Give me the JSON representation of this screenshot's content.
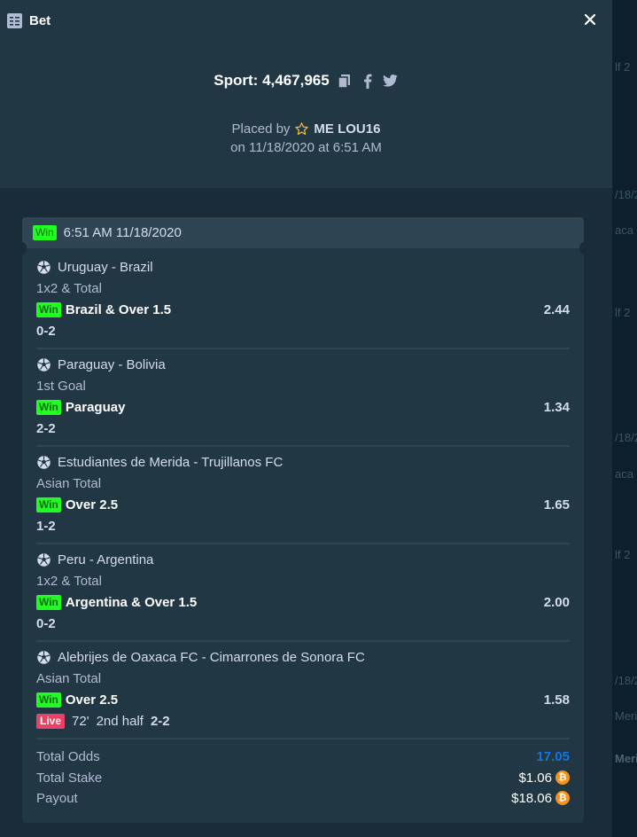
{
  "window": {
    "title": "Bet"
  },
  "header": {
    "sport_label": "Sport: 4,467,965",
    "placed_by_prefix": "Placed by",
    "username": "ME LOU16",
    "placed_on": "on 11/18/2020 at 6:51 AM"
  },
  "card": {
    "status": "Win",
    "timestamp": "6:51 AM 11/18/2020"
  },
  "legs": [
    {
      "match": "Uruguay - Brazil",
      "market": "1x2 & Total",
      "status": "Win",
      "pick": "Brazil & Over 1.5",
      "odds": "2.44",
      "score": "0-2"
    },
    {
      "match": "Paraguay - Bolivia",
      "market": "1st Goal",
      "status": "Win",
      "pick": "Paraguay",
      "odds": "1.34",
      "score": "2-2"
    },
    {
      "match": "Estudiantes de Merida - Trujillanos FC",
      "market": "Asian Total",
      "status": "Win",
      "pick": "Over 2.5",
      "odds": "1.65",
      "score": "1-2"
    },
    {
      "match": "Peru - Argentina",
      "market": "1x2 & Total",
      "status": "Win",
      "pick": "Argentina & Over 1.5",
      "odds": "2.00",
      "score": "0-2"
    },
    {
      "match": "Alebrijes de Oaxaca FC - Cimarrones de Sonora FC",
      "market": "Asian Total",
      "status": "Win",
      "pick": "Over 2.5",
      "odds": "1.58",
      "live_badge": "Live",
      "minute": "72'",
      "period": "2nd half",
      "score": "2-2"
    }
  ],
  "totals": {
    "odds_label": "Total Odds",
    "odds_value": "17.05",
    "stake_label": "Total Stake",
    "stake_value": "$1.06",
    "payout_label": "Payout",
    "payout_value": "$18.06"
  },
  "background": {
    "ghost_texts": [
      "lf 2",
      "/18/2",
      "aca",
      "lf 2",
      "/18/2",
      "aca",
      "lf 2",
      "/18/2",
      "Meri",
      "Meri"
    ]
  },
  "colors": {
    "modal_bg": "#1a2c38",
    "header_bg": "#213743",
    "win_green": "#1fff20",
    "live_red": "#ed4163",
    "odds_blue": "#1475e1",
    "btc_orange": "#f7931a"
  },
  "icons": [
    "bet-icon",
    "close-icon",
    "copy-icon",
    "facebook-icon",
    "twitter-icon",
    "star-icon",
    "soccer-ball-icon",
    "bitcoin-icon"
  ]
}
